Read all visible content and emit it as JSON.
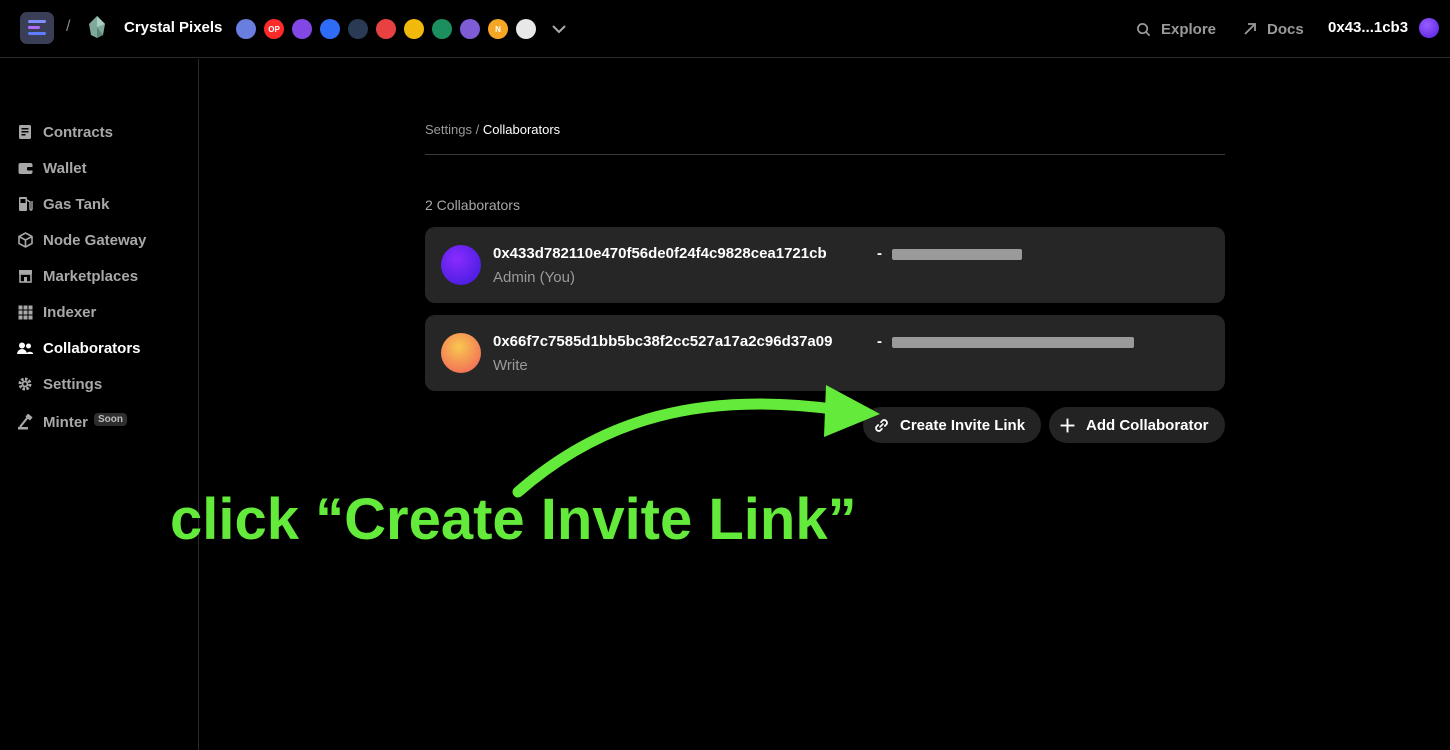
{
  "header": {
    "project_name": "Crystal Pixels",
    "chains": [
      {
        "name": "ethereum-icon",
        "label": "",
        "color": "#6a7ee0"
      },
      {
        "name": "optimism-icon",
        "label": "OP",
        "color": "#ff2a2a"
      },
      {
        "name": "polygon-icon",
        "label": "",
        "color": "#8247e5"
      },
      {
        "name": "base-icon",
        "label": "",
        "color": "#2f6cf6"
      },
      {
        "name": "arbitrum-icon",
        "label": "",
        "color": "#2a3a55"
      },
      {
        "name": "avalanche-icon",
        "label": "",
        "color": "#e84142"
      },
      {
        "name": "bnb-icon",
        "label": "",
        "color": "#f0b90b"
      },
      {
        "name": "moonbeam-icon",
        "label": "",
        "color": "#1c8f5e"
      },
      {
        "name": "astar-icon",
        "label": "",
        "color": "#7d5cd6"
      },
      {
        "name": "xai-icon",
        "label": "N",
        "color": "#f5a623"
      },
      {
        "name": "oasys-icon",
        "label": "",
        "color": "#e8e8e8"
      }
    ],
    "explore_label": "Explore",
    "docs_label": "Docs",
    "wallet_address": "0x43...1cb3"
  },
  "sidebar": {
    "items": [
      {
        "label": "Contracts",
        "icon": "contract-icon",
        "active": false
      },
      {
        "label": "Wallet",
        "icon": "wallet-icon",
        "active": false
      },
      {
        "label": "Gas Tank",
        "icon": "gas-pump-icon",
        "active": false
      },
      {
        "label": "Node Gateway",
        "icon": "cube-icon",
        "active": false
      },
      {
        "label": "Marketplaces",
        "icon": "storefront-icon",
        "active": false
      },
      {
        "label": "Indexer",
        "icon": "grid-icon",
        "active": false
      },
      {
        "label": "Collaborators",
        "icon": "users-icon",
        "active": true
      },
      {
        "label": "Settings",
        "icon": "gear-icon",
        "active": false
      },
      {
        "label": "Minter",
        "icon": "minter-icon",
        "active": false,
        "badge": "Soon"
      }
    ]
  },
  "main": {
    "breadcrumb_parent": "Settings",
    "breadcrumb_separator": "/",
    "breadcrumb_current": "Collaborators",
    "count_label": "2 Collaborators",
    "collaborators": [
      {
        "address": "0x433d782110e470f56de0f24f4c9828cea1721cb",
        "role": "Admin (You)",
        "separator": "-",
        "avatar_colors": [
          "#8a2cff",
          "#3a1ad8"
        ]
      },
      {
        "address": "0x66f7c7585d1bb5bc38f2cc527a17a2c96d37a09",
        "role": "Write",
        "separator": "-",
        "avatar_colors": [
          "#f9c74f",
          "#f05a5a"
        ]
      }
    ],
    "create_invite_label": "Create Invite Link",
    "add_collaborator_label": "Add Collaborator"
  },
  "annotation": {
    "text": "click “Create Invite Link”",
    "color": "#63ea3a"
  }
}
